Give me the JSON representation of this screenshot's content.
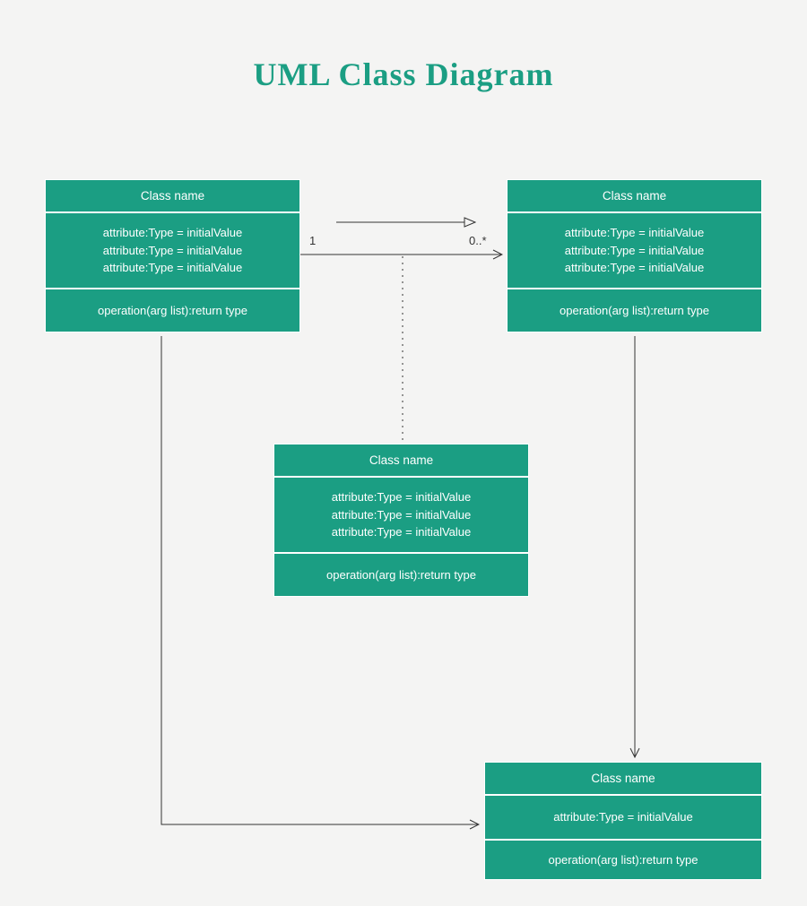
{
  "title": "UML Class Diagram",
  "classes": {
    "topLeft": {
      "name": "Class name",
      "attrs": [
        "attribute:Type = initialValue",
        "attribute:Type = initialValue",
        "attribute:Type = initialValue"
      ],
      "op": "operation(arg list):return type"
    },
    "topRight": {
      "name": "Class name",
      "attrs": [
        "attribute:Type = initialValue",
        "attribute:Type = initialValue",
        "attribute:Type = initialValue"
      ],
      "op": "operation(arg list):return type"
    },
    "middle": {
      "name": "Class name",
      "attrs": [
        "attribute:Type = initialValue",
        "attribute:Type = initialValue",
        "attribute:Type = initialValue"
      ],
      "op": "operation(arg list):return type"
    },
    "bottom": {
      "name": "Class name",
      "attrs": [
        "attribute:Type = initialValue"
      ],
      "op": "operation(arg list):return type"
    }
  },
  "multiplicities": {
    "left": "1",
    "right": "0..*"
  },
  "colors": {
    "primary": "#1b9e83",
    "bg": "#f4f4f3"
  }
}
